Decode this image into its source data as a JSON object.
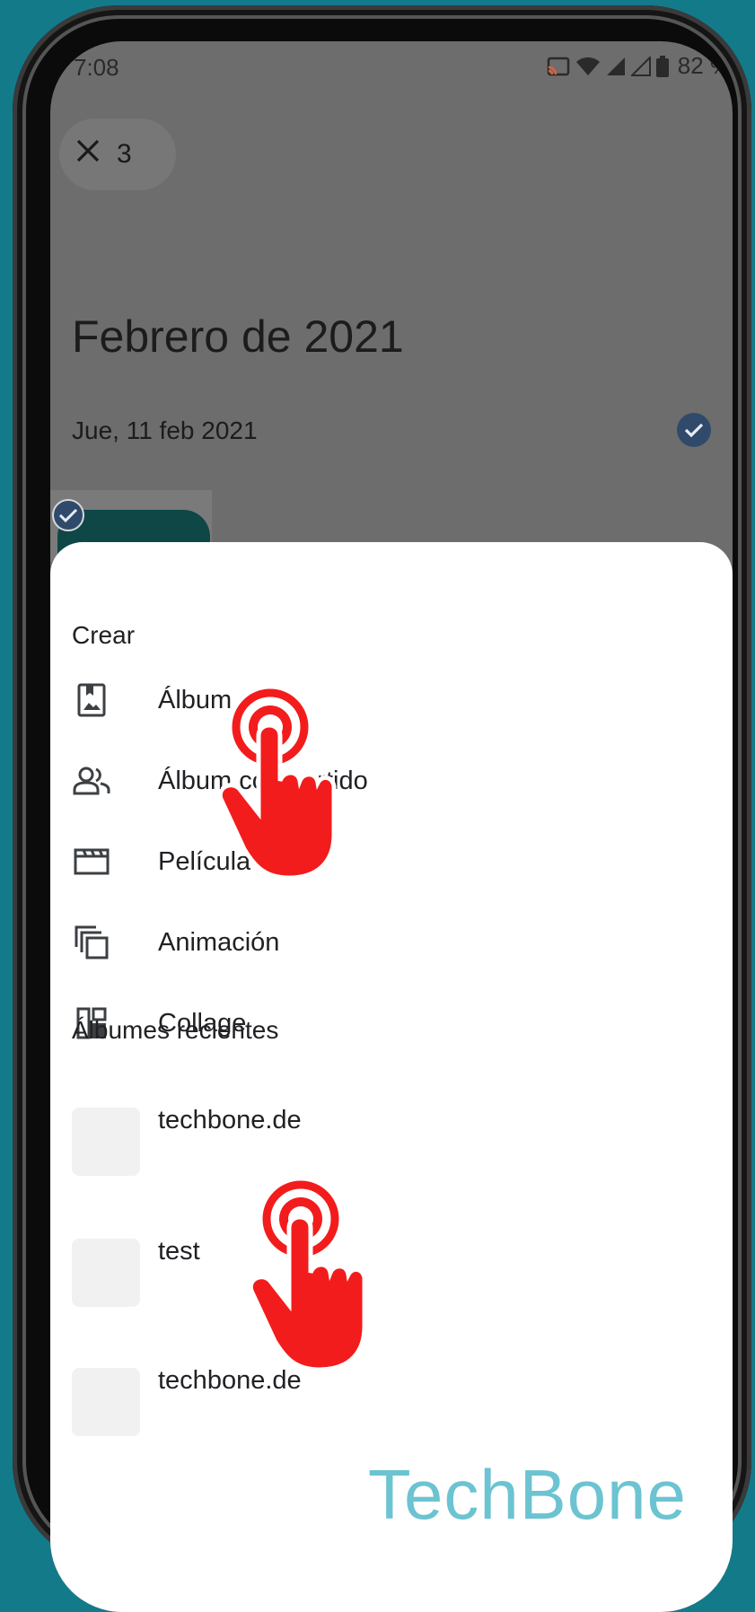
{
  "status_bar": {
    "time": "7:08",
    "battery": "82 %"
  },
  "selection": {
    "close_icon": "close-icon",
    "count": "3"
  },
  "timeline": {
    "month_title": "Febrero de 2021",
    "date_label": "Jue, 11 feb 2021"
  },
  "sheet": {
    "create_title": "Crear",
    "create_items": [
      {
        "icon": "album-icon",
        "label": "Álbum"
      },
      {
        "icon": "shared-album-icon",
        "label": "Álbum compartido"
      },
      {
        "icon": "movie-icon",
        "label": "Película"
      },
      {
        "icon": "animation-icon",
        "label": "Animación"
      },
      {
        "icon": "collage-icon",
        "label": "Collage"
      }
    ],
    "recent_title": "Álbumes recientes",
    "recent_albums": [
      {
        "label": "techbone.de"
      },
      {
        "label": "test"
      },
      {
        "label": "techbone.de"
      }
    ]
  },
  "watermark": "TechBone",
  "colors": {
    "background": "#137a8a",
    "scrim": "#6d6d6d",
    "check": "#2f4a6b",
    "tap_hand": "#f31c1c",
    "watermark": "#6cc3d1"
  }
}
